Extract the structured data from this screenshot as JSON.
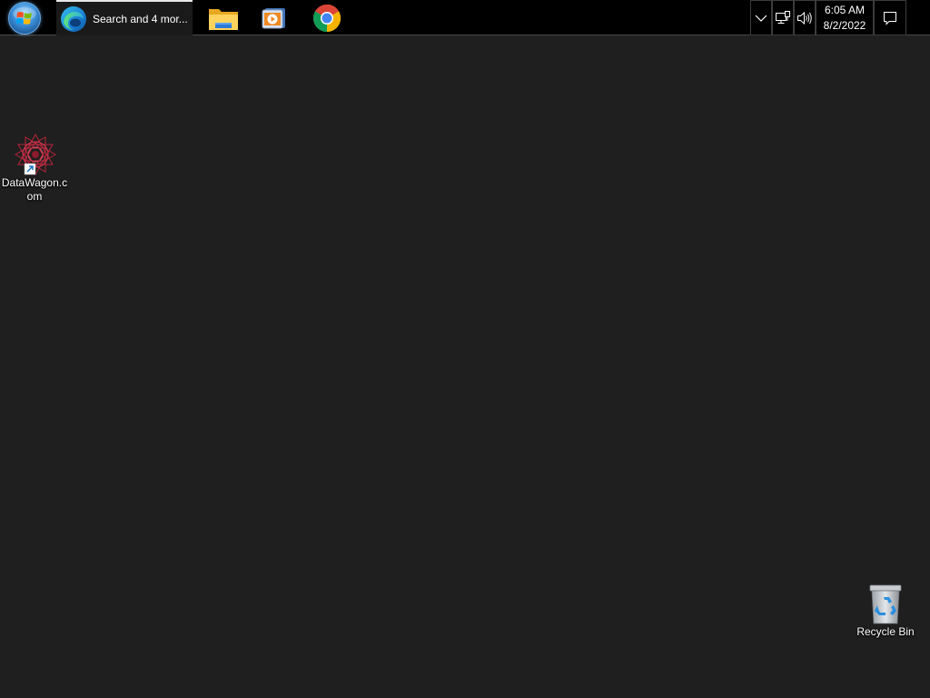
{
  "taskbar": {
    "start": {
      "icon": "windows-orb-icon"
    },
    "edge_task": {
      "label": "Search and 4 mor...",
      "icon": "edge-icon"
    },
    "pinned": [
      {
        "name": "file-explorer",
        "icon": "folder-icon"
      },
      {
        "name": "media-player",
        "icon": "media-player-icon"
      },
      {
        "name": "chrome",
        "icon": "chrome-icon"
      }
    ],
    "tray": {
      "overflow_icon": "chevron-down-icon",
      "network_icon": "network-icon",
      "volume_icon": "speaker-icon",
      "time": "6:05 AM",
      "date": "8/2/2022",
      "notification_icon": "action-center-icon"
    }
  },
  "desktop": {
    "icons": [
      {
        "label": "DataWagon.com",
        "icon": "datawagon-shortcut-icon"
      },
      {
        "label": "Recycle Bin",
        "icon": "recycle-bin-icon"
      }
    ],
    "background_color": "#1f1f1f"
  }
}
